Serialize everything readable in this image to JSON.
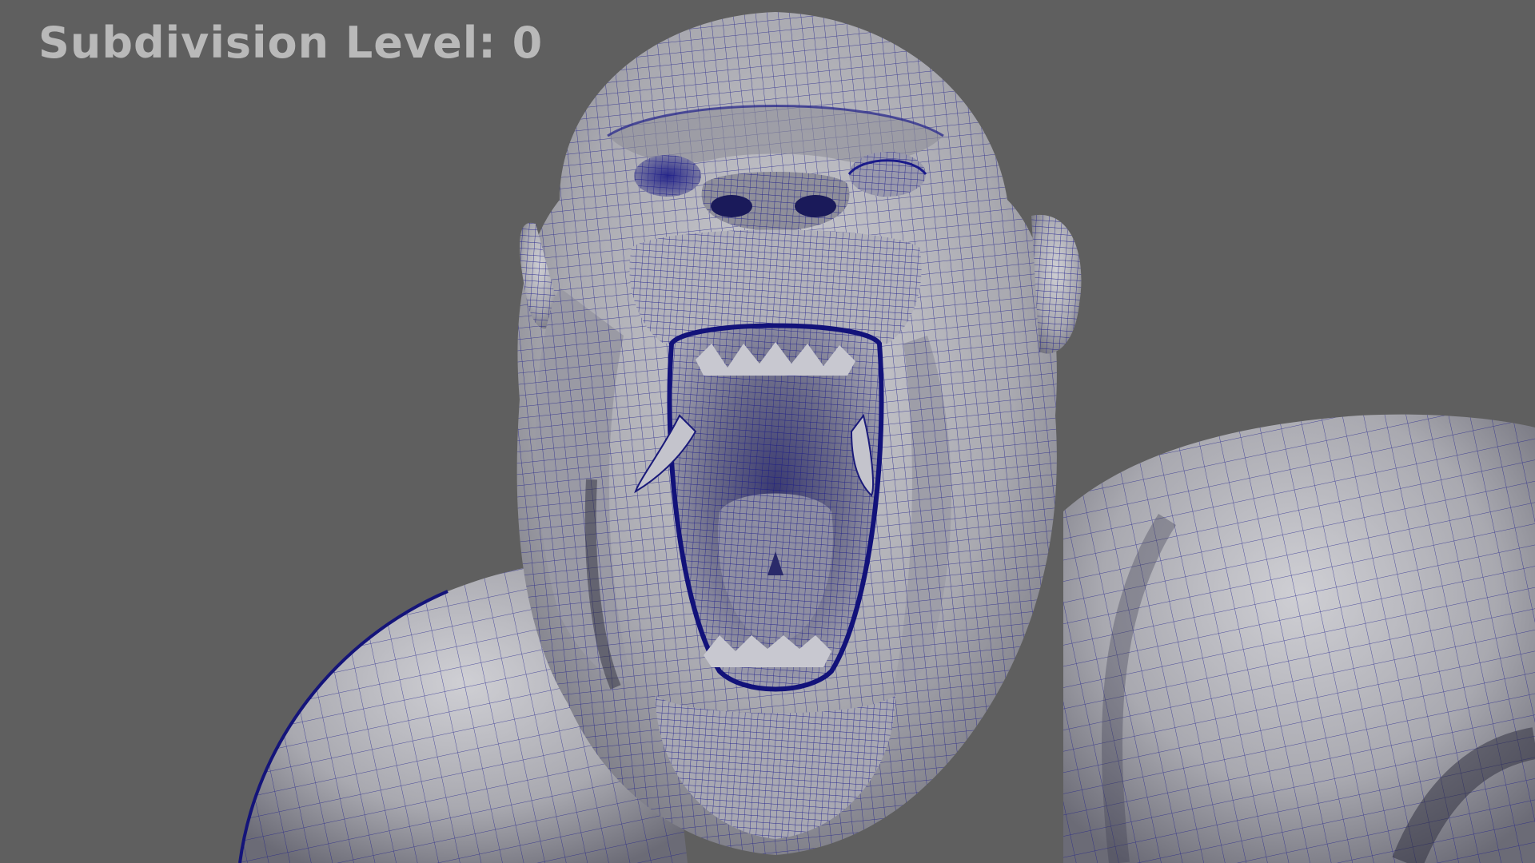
{
  "viewport": {
    "subdivision_label": "Subdivision Level: 0",
    "background_color": "#5f5f5f"
  },
  "model": {
    "name": "gorilla-wireframe-mesh",
    "surface_color": "#b4b4bc",
    "shadow_color": "#4a4a58",
    "wire_color": "#1a1a8c"
  }
}
